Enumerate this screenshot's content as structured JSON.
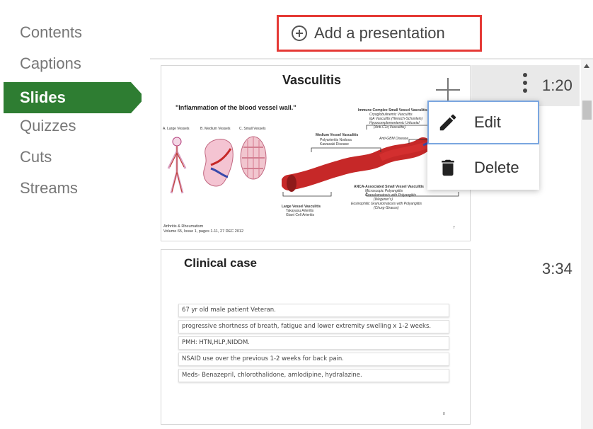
{
  "sidebar": {
    "items": [
      {
        "label": "Contents"
      },
      {
        "label": "Captions"
      },
      {
        "label": "Slides"
      },
      {
        "label": "Quizzes"
      },
      {
        "label": "Cuts"
      },
      {
        "label": "Streams"
      }
    ],
    "active_color": "#2e7d32"
  },
  "header": {
    "add_presentation_label": "Add a presentation"
  },
  "slides": [
    {
      "title": "Vasculitis",
      "time": "1:20",
      "quote": "\"Inflammation of the blood vessel wall.\"",
      "vessel_labels": [
        "A. Large Vessels",
        "B. Medium Vessels",
        "C. Small Vessels"
      ],
      "medium_vessel": {
        "title": "Medium Vessel Vasculitis",
        "items": [
          "Polyarteritis Nodosa",
          "Kawasaki Disease"
        ]
      },
      "immune_complex": {
        "title": "Immune Complex Small Vessel Vasculitis",
        "items": [
          "Cryoglobulinemic Vasculitis",
          "IgA Vasculitis (Henoch-Schonlein)",
          "Hypocomplementemic Urticarial",
          "(Anti-C1q Vasculitis)"
        ]
      },
      "anti_gbm": "Anti-GBM Disease",
      "anca": {
        "title": "ANCA-Associated Small Vessel Vasculitis",
        "items": [
          "Microscopic Polyangiitis",
          "Granulomatosis with Polyangiitis",
          "(Wegener's)",
          "Eosinophilic Granulomatosis with Polyangiitis",
          "(Churg-Strauss)"
        ]
      },
      "large_vessel": {
        "title": "Large Vessel Vasculitis",
        "items": [
          "Takayasu Arteritis",
          "Giant Cell Arteritis"
        ]
      },
      "source_line1": "Arthritis & Rheumatism",
      "source_line2": "Volume 65, Issue 1, pages 1-11, 27 DEC 2012",
      "slide_number": "7"
    },
    {
      "title": "Clinical case",
      "time": "3:34",
      "lines": [
        "67 yr old male patient Veteran.",
        "progressive shortness of breath, fatigue and lower extremity swelling x 1-2 weeks.",
        "PMH: HTN,HLP,NIDDM.",
        "NSAID use over the previous 1-2 weeks for back pain.",
        "Meds- Benazepril, chlorothalidone, amlodipine, hydralazine."
      ],
      "slide_number": "8"
    }
  ],
  "context_menu": {
    "items": [
      {
        "label": "Edit",
        "icon": "pencil-icon"
      },
      {
        "label": "Delete",
        "icon": "trash-icon"
      }
    ]
  },
  "colors": {
    "highlight_border": "#e53935",
    "menu_focus": "#7aa6e0",
    "vessel_red": "#c62828"
  }
}
